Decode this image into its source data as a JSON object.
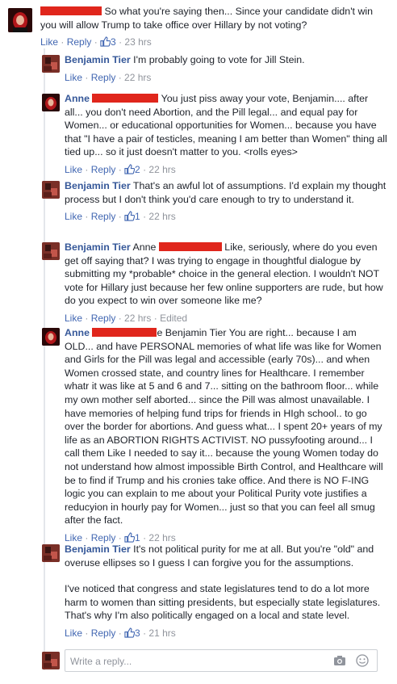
{
  "comments": [
    {
      "text": " So what you're saying then... Since your candidate didn't win you will allow Trump to take office over Hillary by not voting?",
      "actions": {
        "like": "Like",
        "reply": "Reply",
        "likes": "3",
        "time": "23 hrs"
      }
    },
    {
      "author": "Benjamin Tier",
      "text": " I'm probably going to vote for Jill Stein.",
      "actions": {
        "like": "Like",
        "reply": "Reply",
        "time": "22 hrs"
      }
    },
    {
      "author": "Anne",
      "text": " You just piss away your vote, Benjamin.... after all... you don't need Abortion, and the Pill legal... and equal pay for Women... or educational opportunities for Women... because you have that \"I have a pair of testicles, meaning I am better than Women\" thing all tied up... so it just doesn't matter to you. <rolls eyes>",
      "actions": {
        "like": "Like",
        "reply": "Reply",
        "likes": "2",
        "time": "22 hrs"
      }
    },
    {
      "author": "Benjamin Tier",
      "text": " That's an awful lot of assumptions. I'd explain my thought process but I don't think you'd care enough to try to understand it.",
      "actions": {
        "like": "Like",
        "reply": "Reply",
        "likes": "1",
        "time": "22 hrs"
      }
    },
    {
      "author": "Benjamin Tier",
      "mention": " Anne ",
      "text": " Like, seriously, where do you even get off saying that? I was trying to engage in thoughtful dialogue by submitting my *probable* choice in the general election. I wouldn't NOT vote for Hillary just because her few online supporters are rude, but how do you expect to win over someone like me?",
      "actions": {
        "like": "Like",
        "reply": "Reply",
        "time": "22 hrs",
        "edited": "Edited"
      }
    },
    {
      "author": "Anne",
      "text": "e Benjamin Tier You are right... because I am OLD... and have PERSONAL memories of what life was like for Women and Girls for the Pill was legal and accessible (early 70s)... and when Women crossed state, and country lines for Healthcare. I remember whatr it was like at 5 and 6 and 7... sitting on the bathroom floor... while my own mother self aborted... since the Pill was almost unavailable. I have memories of helping fund trips for friends in HIgh school.. to go over the border for abortions. And guess what... I spent 20+ years of my life as an ABORTION RIGHTS ACTIVIST. NO pussyfooting around... I call them Like I needed to say it... because the young Women today do not understand how almost impossible Birth Control, and Healthcare will be to find if Trump and his cronies take office. And there is NO F-ING logic you can explain to me about your Political Purity vote justifies a reducyion in hourly pay for Women... just so that you can feel all smug after the fact.",
      "actions": {
        "like": "Like",
        "reply": "Reply",
        "likes": "1",
        "time": "22 hrs"
      }
    },
    {
      "author": "Benjamin Tier",
      "text": " It's not political purity for me at all. But you're \"old\" and overuse ellipses so I guess I can forgive you for the assumptions.",
      "text2": "I've noticed that congress and state legislatures tend to do a lot more harm to women than sitting presidents, but especially state legislatures. That's why I'm also politically engaged on a local and state level.",
      "actions": {
        "like": "Like",
        "reply": "Reply",
        "likes": "3",
        "time": "21 hrs"
      }
    }
  ],
  "reply_box": {
    "placeholder": "Write a reply..."
  },
  "sep": " · "
}
